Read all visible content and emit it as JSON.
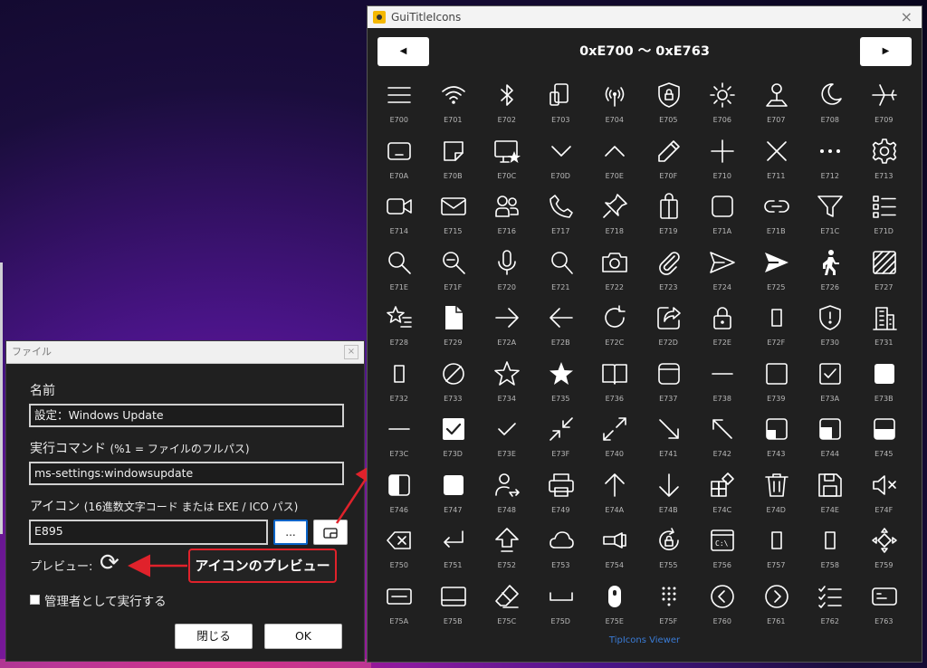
{
  "dialog": {
    "title": "ファイル",
    "close_glyph": "×",
    "name_label": "名前",
    "name_value": "設定：Windows Update",
    "command_label": "実行コマンド",
    "command_hint": "(%1 = ファイルのフルパス)",
    "command_value": "ms-settings:windowsupdate",
    "icon_label": "アイコン",
    "icon_hint": "(16進数文字コード または EXE / ICO パス)",
    "icon_value": "E895",
    "browse_label": "...",
    "preview_label": "プレビュー:",
    "preview_glyph": "⟳",
    "admin_label": "管理者として実行する",
    "close_button": "閉じる",
    "ok_button": "OK"
  },
  "callout": {
    "text": "アイコンのプレビュー"
  },
  "viewer": {
    "title": "GuiTitleIcons",
    "close_glyph": "×",
    "prev_glyph": "◀",
    "next_glyph": "▶",
    "range": "0xE700 ～ 0xE763",
    "footer": "TipIcons Viewer",
    "icons": [
      {
        "code": "E700",
        "name": "hamburger-menu-icon"
      },
      {
        "code": "E701",
        "name": "wifi-icon"
      },
      {
        "code": "E702",
        "name": "bluetooth-icon"
      },
      {
        "code": "E703",
        "name": "connect-devices-icon"
      },
      {
        "code": "E704",
        "name": "antenna-icon"
      },
      {
        "code": "E705",
        "name": "shield-lock-icon"
      },
      {
        "code": "E706",
        "name": "brightness-icon"
      },
      {
        "code": "E707",
        "name": "map-pin-icon"
      },
      {
        "code": "E708",
        "name": "moon-icon"
      },
      {
        "code": "E709",
        "name": "airplane-icon"
      },
      {
        "code": "E70A",
        "name": "tablet-icon"
      },
      {
        "code": "E70B",
        "name": "sticky-note-icon"
      },
      {
        "code": "E70C",
        "name": "featured-screen-icon"
      },
      {
        "code": "E70D",
        "name": "chevron-down-icon"
      },
      {
        "code": "E70E",
        "name": "chevron-up-icon"
      },
      {
        "code": "E70F",
        "name": "pencil-icon"
      },
      {
        "code": "E710",
        "name": "add-icon"
      },
      {
        "code": "E711",
        "name": "cancel-icon"
      },
      {
        "code": "E712",
        "name": "more-icon"
      },
      {
        "code": "E713",
        "name": "gear-icon"
      },
      {
        "code": "E714",
        "name": "video-icon"
      },
      {
        "code": "E715",
        "name": "mail-icon"
      },
      {
        "code": "E716",
        "name": "people-icon"
      },
      {
        "code": "E717",
        "name": "phone-icon"
      },
      {
        "code": "E718",
        "name": "pin-icon"
      },
      {
        "code": "E719",
        "name": "shop-icon"
      },
      {
        "code": "E71A",
        "name": "stop-icon"
      },
      {
        "code": "E71B",
        "name": "link-icon"
      },
      {
        "code": "E71C",
        "name": "filter-icon"
      },
      {
        "code": "E71D",
        "name": "all-apps-icon"
      },
      {
        "code": "E71E",
        "name": "zoom-icon"
      },
      {
        "code": "E71F",
        "name": "zoom-out-icon"
      },
      {
        "code": "E720",
        "name": "microphone-icon"
      },
      {
        "code": "E721",
        "name": "search-icon"
      },
      {
        "code": "E722",
        "name": "camera-icon"
      },
      {
        "code": "E723",
        "name": "attach-icon"
      },
      {
        "code": "E724",
        "name": "send-icon"
      },
      {
        "code": "E725",
        "name": "send-fill-icon"
      },
      {
        "code": "E726",
        "name": "walk-solid-icon"
      },
      {
        "code": "E727",
        "name": "in-private-icon"
      },
      {
        "code": "E728",
        "name": "favorite-list-icon"
      },
      {
        "code": "E729",
        "name": "page-solid-icon"
      },
      {
        "code": "E72A",
        "name": "forward-icon"
      },
      {
        "code": "E72B",
        "name": "back-icon"
      },
      {
        "code": "E72C",
        "name": "refresh-icon"
      },
      {
        "code": "E72D",
        "name": "share-icon"
      },
      {
        "code": "E72E",
        "name": "lock-icon"
      },
      {
        "code": "E72F",
        "name": "report-hacked-icon"
      },
      {
        "code": "E730",
        "name": "shield-exclamation-icon"
      },
      {
        "code": "E731",
        "name": "building-icon"
      },
      {
        "code": "E732",
        "name": "phone-small-icon"
      },
      {
        "code": "E733",
        "name": "blocked-icon"
      },
      {
        "code": "E734",
        "name": "star-outline-icon"
      },
      {
        "code": "E735",
        "name": "star-fill-icon"
      },
      {
        "code": "E736",
        "name": "reading-mode-icon"
      },
      {
        "code": "E737",
        "name": "favicon-icon"
      },
      {
        "code": "E738",
        "name": "remove-icon"
      },
      {
        "code": "E739",
        "name": "checkbox-icon"
      },
      {
        "code": "E73A",
        "name": "checkbox-composite-icon"
      },
      {
        "code": "E73B",
        "name": "checkbox-fill-icon"
      },
      {
        "code": "E73C",
        "name": "checkbox-indeterminate-icon"
      },
      {
        "code": "E73D",
        "name": "checkbox-composite-reversed-icon"
      },
      {
        "code": "E73E",
        "name": "checkmark-icon"
      },
      {
        "code": "E73F",
        "name": "back-to-window-icon"
      },
      {
        "code": "E740",
        "name": "full-screen-icon"
      },
      {
        "code": "E741",
        "name": "resize-touch-larger-icon"
      },
      {
        "code": "E742",
        "name": "resize-touch-smaller-icon"
      },
      {
        "code": "E743",
        "name": "resize-mouse-small-icon"
      },
      {
        "code": "E744",
        "name": "resize-mouse-medium-icon"
      },
      {
        "code": "E745",
        "name": "resize-mouse-wide-icon"
      },
      {
        "code": "E746",
        "name": "resize-mouse-tall-icon"
      },
      {
        "code": "E747",
        "name": "resize-mouse-large-icon"
      },
      {
        "code": "E748",
        "name": "switch-user-icon"
      },
      {
        "code": "E749",
        "name": "print-icon"
      },
      {
        "code": "E74A",
        "name": "up-icon"
      },
      {
        "code": "E74B",
        "name": "down-icon"
      },
      {
        "code": "E74C",
        "name": "ome-icon"
      },
      {
        "code": "E74D",
        "name": "delete-icon"
      },
      {
        "code": "E74E",
        "name": "save-icon"
      },
      {
        "code": "E74F",
        "name": "mute-icon"
      },
      {
        "code": "E750",
        "name": "backspace-icon"
      },
      {
        "code": "E751",
        "name": "return-key-icon"
      },
      {
        "code": "E752",
        "name": "up-arrow-shift-key-icon"
      },
      {
        "code": "E753",
        "name": "cloud-icon"
      },
      {
        "code": "E754",
        "name": "flashlight-icon"
      },
      {
        "code": "E755",
        "name": "rotation-lock-icon"
      },
      {
        "code": "E756",
        "name": "command-prompt-icon"
      },
      {
        "code": "E757",
        "name": "sip-move-icon"
      },
      {
        "code": "E758",
        "name": "sip-undock-icon"
      },
      {
        "code": "E759",
        "name": "sip-redock-icon"
      },
      {
        "code": "E75A",
        "name": "eraser-tool-icon"
      },
      {
        "code": "E75B",
        "name": "keyboard-icon"
      },
      {
        "code": "E75C",
        "name": "eraser-icon"
      },
      {
        "code": "E75D",
        "name": "space-icon"
      },
      {
        "code": "E75E",
        "name": "mouse-icon"
      },
      {
        "code": "E75F",
        "name": "dial-pad-icon"
      },
      {
        "code": "E760",
        "name": "previous-icon"
      },
      {
        "code": "E761",
        "name": "next-icon"
      },
      {
        "code": "E762",
        "name": "multi-select-icon"
      },
      {
        "code": "E763",
        "name": "card-icon"
      }
    ]
  }
}
